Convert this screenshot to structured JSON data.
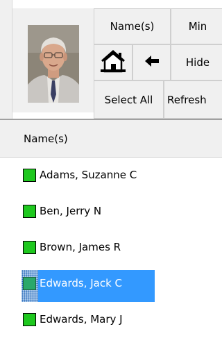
{
  "toolbar": {
    "names_button": "Name(s)",
    "min_button": "Min",
    "hide_button": "Hide",
    "select_all_button": "Select All",
    "refresh_button": "Refresh",
    "home_icon": "home-icon",
    "back_icon": "left-arrow-icon"
  },
  "list": {
    "header": "Name(s)",
    "items": [
      {
        "label": "Adams, Suzanne C",
        "status_color": "#1ec81e",
        "selected": false
      },
      {
        "label": "Ben, Jerry N",
        "status_color": "#1ec81e",
        "selected": false
      },
      {
        "label": "Brown, James R",
        "status_color": "#1ec81e",
        "selected": false
      },
      {
        "label": "Edwards, Jack C",
        "status_color": "#2aa86a",
        "selected": true
      },
      {
        "label": "Edwards, Mary J",
        "status_color": "#1ec81e",
        "selected": false
      }
    ]
  },
  "colors": {
    "selection": "#3399ff",
    "button_face": "#f0f0f0"
  }
}
